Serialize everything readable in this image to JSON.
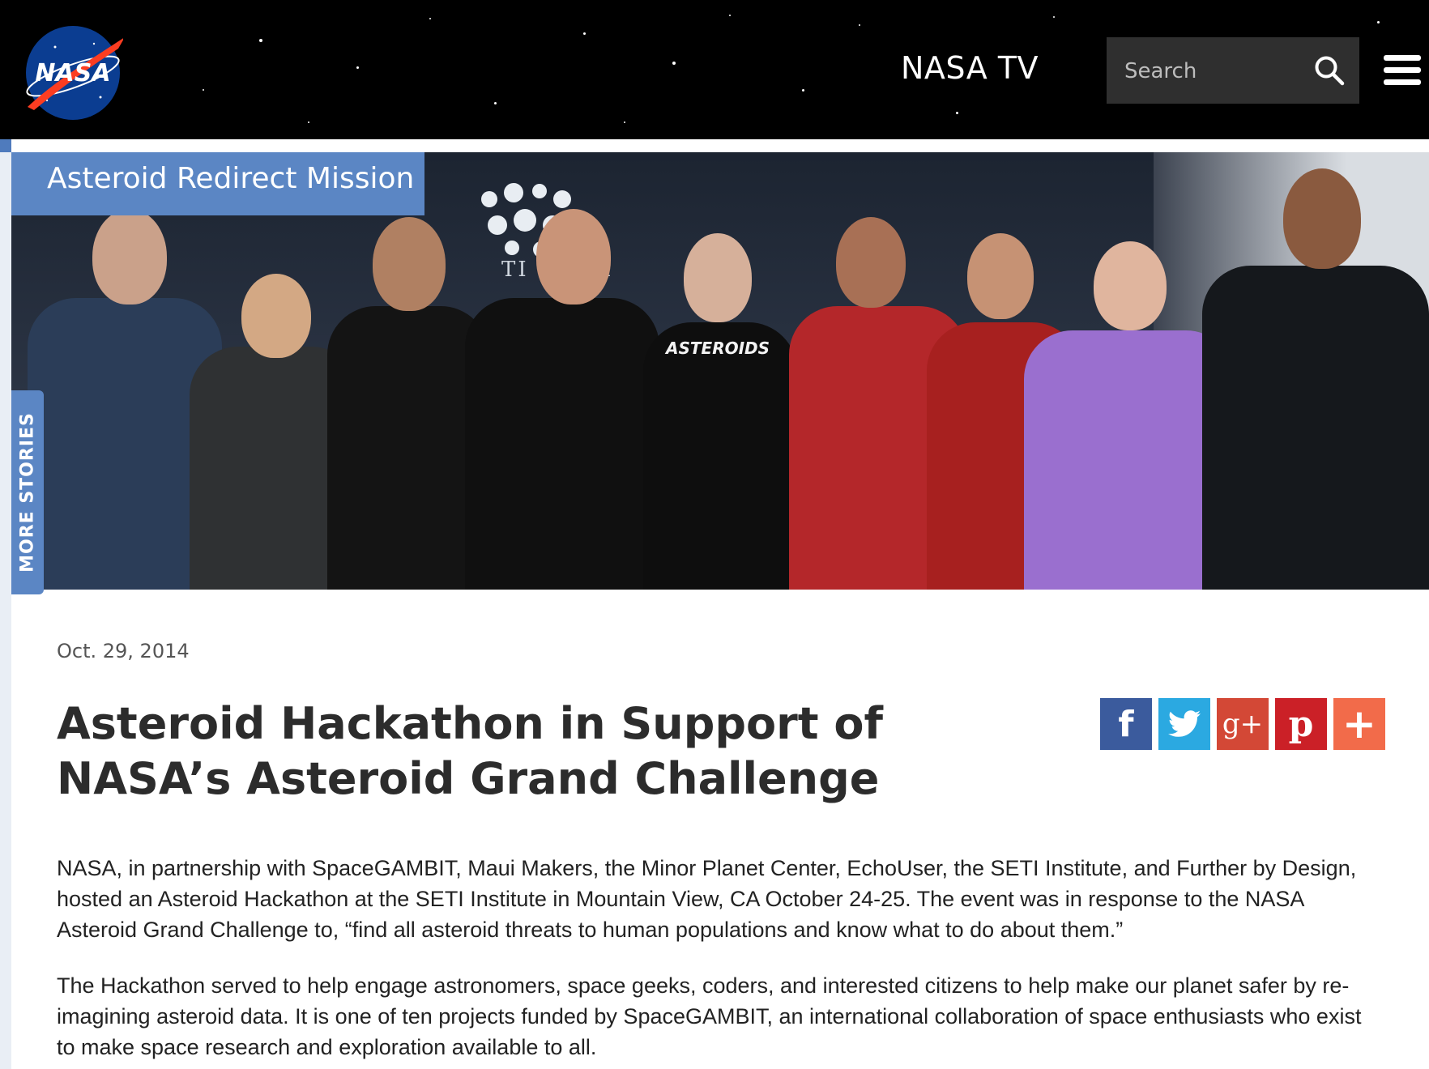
{
  "header": {
    "logo_text": "NASA",
    "nasa_tv_label": "NASA TV",
    "search_placeholder": "Search",
    "icons": {
      "search": "search-icon",
      "menu": "hamburger-menu-icon",
      "logo": "nasa-meatball-logo"
    }
  },
  "hero": {
    "category_label": "Asteroid Redirect Mission",
    "more_stories_label": "MORE STORIES",
    "shirt_text": "ASTEROIDS",
    "wall_text": "TI INSTI"
  },
  "article": {
    "date": "Oct. 29, 2014",
    "title": "Asteroid Hackathon in Support of NASA’s Asteroid Grand Challenge",
    "paragraphs": [
      "NASA, in partnership with SpaceGAMBIT, Maui Makers, the Minor Planet Center, EchoUser, the SETI Institute, and Further by Design, hosted an Asteroid Hackathon at the SETI Institute in Mountain View, CA October 24-25. The event was in response to the NASA Asteroid Grand Challenge to, “find all asteroid threats to human populations and know what to do about them.”",
      "The Hackathon served to help engage astronomers, space geeks, coders, and interested citizens to help make our planet safer by re-imagining asteroid data. It is one of ten projects funded by SpaceGAMBIT, an international collaboration of space enthusiasts who exist to make space research and exploration available to all."
    ]
  },
  "share": {
    "buttons": [
      {
        "name": "facebook",
        "glyph": "f",
        "color": "#3b5b9d"
      },
      {
        "name": "twitter",
        "glyph": "t",
        "color": "#2ba9e1"
      },
      {
        "name": "google-plus",
        "glyph": "g+",
        "color": "#d34836"
      },
      {
        "name": "pinterest",
        "glyph": "p",
        "color": "#cb2027"
      },
      {
        "name": "more",
        "glyph": "+",
        "color": "#f26b4a"
      }
    ]
  },
  "colors": {
    "accent_blue": "#5b86c4",
    "band_blue": "#4f7bbd",
    "header_bg": "#000000",
    "search_bg": "#2f2f2f"
  }
}
